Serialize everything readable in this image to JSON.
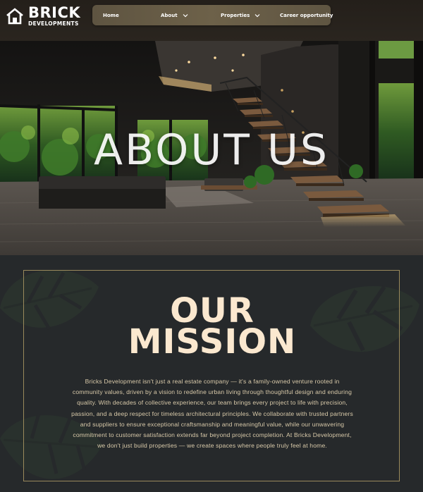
{
  "brand": {
    "name": "BRICK",
    "subtitle": "DEVELOPMENTS"
  },
  "nav": {
    "items": [
      {
        "label": "Home",
        "has_dropdown": false
      },
      {
        "label": "About",
        "has_dropdown": true
      },
      {
        "label": "Properties",
        "has_dropdown": true
      },
      {
        "label": "Career opportunity",
        "has_dropdown": false
      }
    ]
  },
  "hero": {
    "title": "ABOUT US"
  },
  "mission": {
    "title_line1": "OUR",
    "title_line2": "MISSION",
    "body": "Bricks Development isn't just a real estate company — it's a family-owned venture rooted in community values, driven by a vision to redefine urban living through thoughtful design and enduring quality. With decades of collective experience, our team brings every project to life with precision, passion, and a deep respect for timeless architectural principles. We collaborate with trusted partners and suppliers to ensure exceptional craftsmanship and meaningful value, while our unwavering commitment to customer satisfaction extends far beyond project completion. At Bricks Development, we don't just build properties — we create spaces where people truly feel at home."
  },
  "colors": {
    "nav_bg": "#6a5f48",
    "mission_title": "#fbe8cf",
    "mission_text": "#d8c9a9",
    "frame_border": "#9a8a5c",
    "section_bg": "#26292b"
  }
}
